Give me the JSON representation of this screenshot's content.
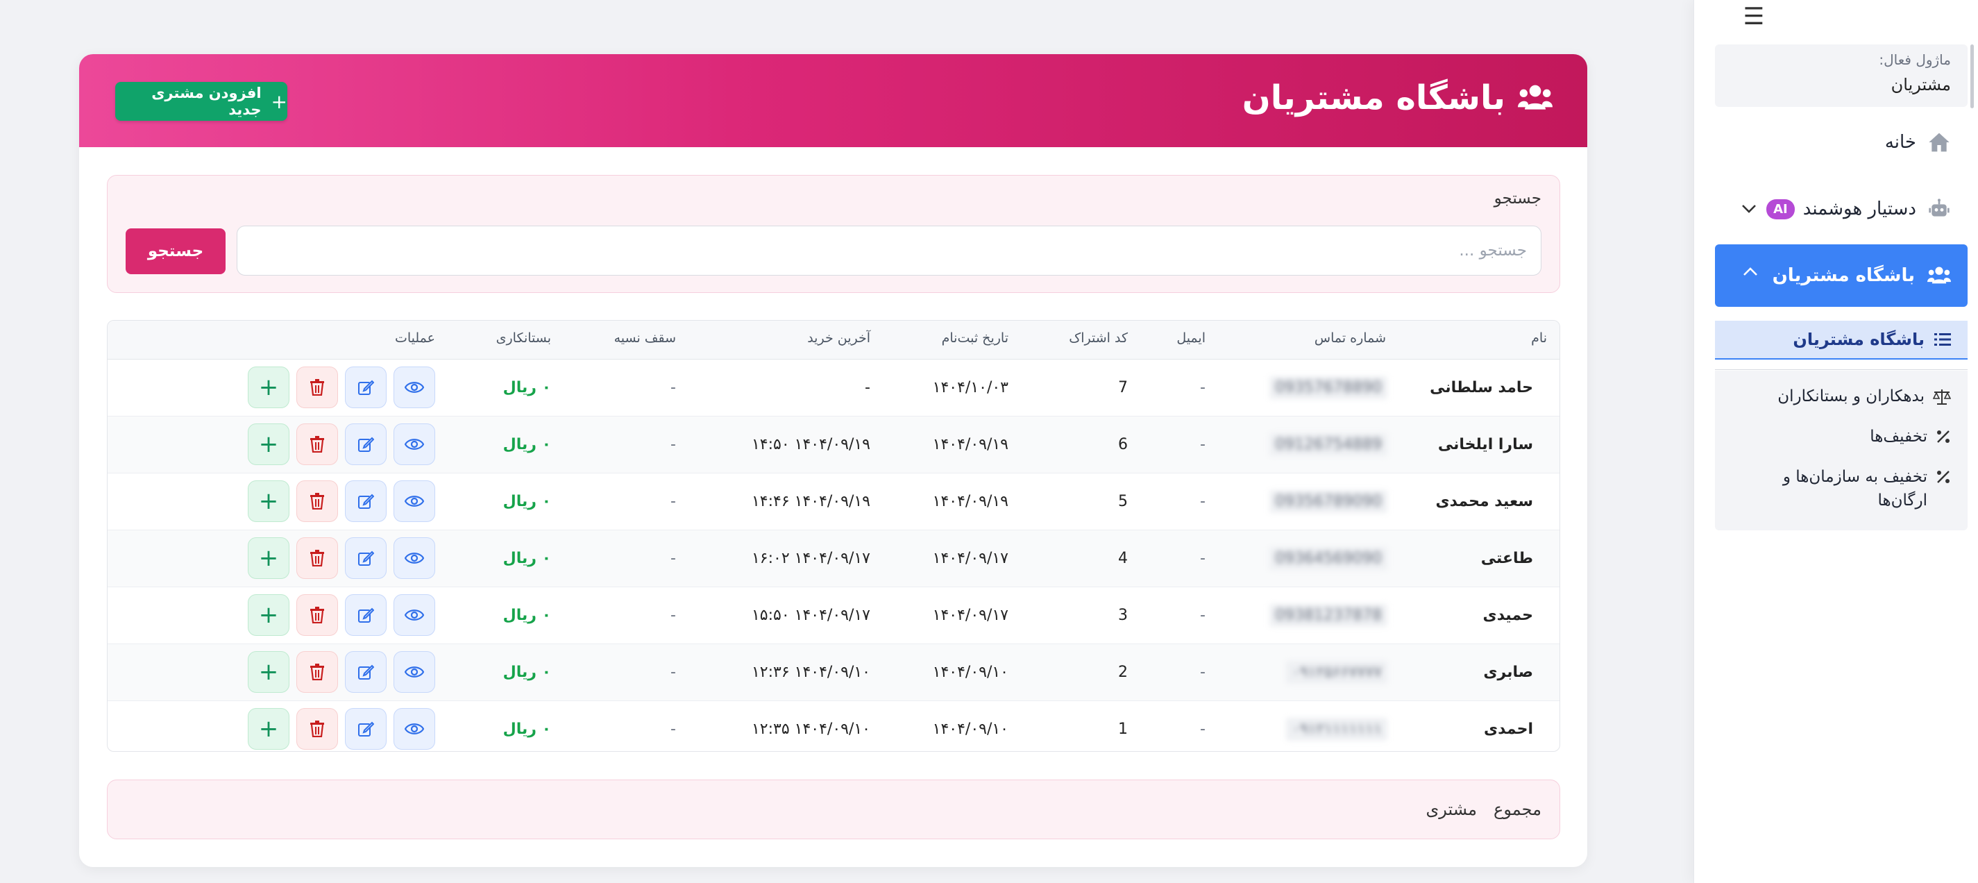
{
  "sidebar": {
    "active_module_label": "ماژول فعال:",
    "active_module_value": "مشتریان",
    "items": {
      "home": "خانه",
      "assistant": "دستیار هوشمند",
      "assistant_badge": "AI",
      "club": "باشگاه مشتریان"
    },
    "sub_active": "باشگاه مشتریان",
    "sub_items": [
      "بدهکاران و بستانکاران",
      "تخفیف‌ها",
      "تخفیف به سازمان‌ها و ارگان‌ها"
    ]
  },
  "header": {
    "title": "باشگاه مشتریان",
    "add_button": "افزودن مشتری جدید"
  },
  "search": {
    "label": "جستجو",
    "placeholder": "جستجو ...",
    "button": "جستجو"
  },
  "table": {
    "columns": {
      "name": "نام",
      "phone": "شماره تماس",
      "email": "ایمیل",
      "code": "کد اشتراک",
      "reg_date": "تاریخ ثبت‌نام",
      "last_purchase": "آخرین خرید",
      "credit_limit": "سقف نسیه",
      "balance": "بستانکاری",
      "actions": "عملیات"
    },
    "rows": [
      {
        "name": "حامد سلطانی",
        "phone": "09357678890",
        "email": "-",
        "code": "7",
        "reg_date": "۱۴۰۴/۱۰/۰۳",
        "last_purchase": "-",
        "credit_limit": "-",
        "balance": "۰ ریال"
      },
      {
        "name": "سارا ایلخانی",
        "phone": "09126754889",
        "email": "-",
        "code": "6",
        "reg_date": "۱۴۰۴/۰۹/۱۹",
        "last_purchase": "۱۴۰۴/۰۹/۱۹ ۱۴:۵۰",
        "credit_limit": "-",
        "balance": "۰ ریال"
      },
      {
        "name": "سعید محمدی",
        "phone": "09356789090",
        "email": "-",
        "code": "5",
        "reg_date": "۱۴۰۴/۰۹/۱۹",
        "last_purchase": "۱۴۰۴/۰۹/۱۹ ۱۴:۴۶",
        "credit_limit": "-",
        "balance": "۰ ریال"
      },
      {
        "name": "طاعتی",
        "phone": "09364569090",
        "email": "-",
        "code": "4",
        "reg_date": "۱۴۰۴/۰۹/۱۷",
        "last_purchase": "۱۴۰۴/۰۹/۱۷ ۱۶:۰۲",
        "credit_limit": "-",
        "balance": "۰ ریال"
      },
      {
        "name": "حمیدی",
        "phone": "09381237878",
        "email": "-",
        "code": "3",
        "reg_date": "۱۴۰۴/۰۹/۱۷",
        "last_purchase": "۱۴۰۴/۰۹/۱۷ ۱۵:۵۰",
        "credit_limit": "-",
        "balance": "۰ ریال"
      },
      {
        "name": "صابری",
        "phone": "۰۹۱۲۵۶۶۷۷۷۷",
        "email": "-",
        "code": "2",
        "reg_date": "۱۴۰۴/۰۹/۱۰",
        "last_purchase": "۱۴۰۴/۰۹/۱۰ ۱۲:۳۶",
        "credit_limit": "-",
        "balance": "۰ ریال"
      },
      {
        "name": "احمدی",
        "phone": "۰۹۱۲۱۱۱۱۱۱۱",
        "email": "-",
        "code": "1",
        "reg_date": "۱۴۰۴/۰۹/۱۰",
        "last_purchase": "۱۴۰۴/۰۹/۱۰ ۱۲:۳۵",
        "credit_limit": "-",
        "balance": "۰ ریال"
      }
    ]
  },
  "footer": {
    "total_label": "مجموع",
    "total_unit": "مشتری"
  },
  "colors": {
    "header_gradient_start": "#ec4899",
    "header_gradient_end": "#c2185b",
    "add_button": "#10a36a",
    "search_button": "#d92a6f",
    "sidebar_active": "#3b82f6",
    "credit_text": "#16a34a"
  }
}
